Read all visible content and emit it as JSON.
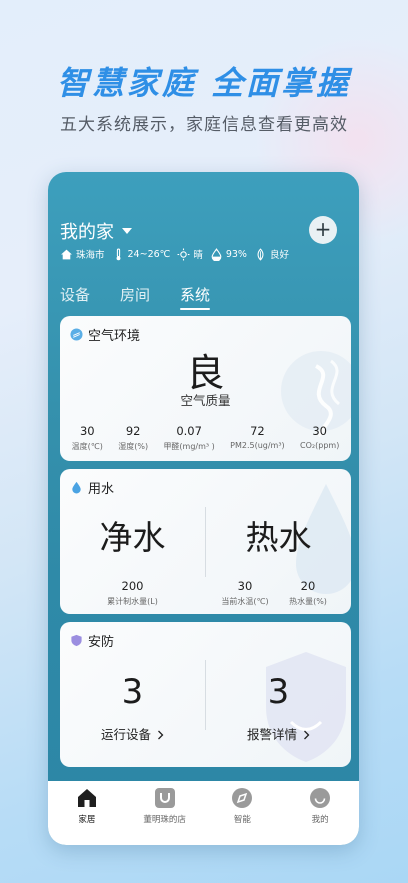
{
  "promo": {
    "headline": "智慧家庭 全面掌握",
    "subline": "五大系统展示，家庭信息查看更高效"
  },
  "header": {
    "home_name": "我的家",
    "add_label": "+",
    "weather": {
      "city": "珠海市",
      "temperature": "24~26℃",
      "condition": "晴",
      "humidity": "93%",
      "air": "良好"
    }
  },
  "tabs": [
    {
      "label": "设备",
      "active": false
    },
    {
      "label": "房间",
      "active": false
    },
    {
      "label": "系统",
      "active": true
    }
  ],
  "air_card": {
    "title": "空气环境",
    "grade": "良",
    "grade_label": "空气质量",
    "metrics": [
      {
        "value": "30",
        "label": "温度(℃)"
      },
      {
        "value": "92",
        "label": "湿度(%)"
      },
      {
        "value": "0.07",
        "label": "甲醛(mg/m³ )"
      },
      {
        "value": "72",
        "label": "PM2.5(ug/m³)"
      },
      {
        "value": "30",
        "label": "CO₂(ppm)"
      }
    ]
  },
  "water_card": {
    "title": "用水",
    "left_label": "净水",
    "right_label": "热水",
    "purified_total": {
      "value": "200",
      "label": "累计制水量(L)"
    },
    "current_temp": {
      "value": "30",
      "label": "当前水温(℃)"
    },
    "hot_water": {
      "value": "20",
      "label": "热水量(%)"
    }
  },
  "security_card": {
    "title": "安防",
    "running_count": "3",
    "running_label": "运行设备",
    "alarm_count": "3",
    "alarm_label": "报警详情"
  },
  "navbar": [
    {
      "label": "家居",
      "icon": "home-icon",
      "active": true
    },
    {
      "label": "董明珠的店",
      "icon": "store-icon",
      "active": false
    },
    {
      "label": "智能",
      "icon": "smart-icon",
      "active": false
    },
    {
      "label": "我的",
      "icon": "profile-icon",
      "active": false
    }
  ],
  "colors": {
    "accent": "#2f8fe6",
    "phone_bg": "#3591ad",
    "card_bg": "#f7f9fb"
  }
}
